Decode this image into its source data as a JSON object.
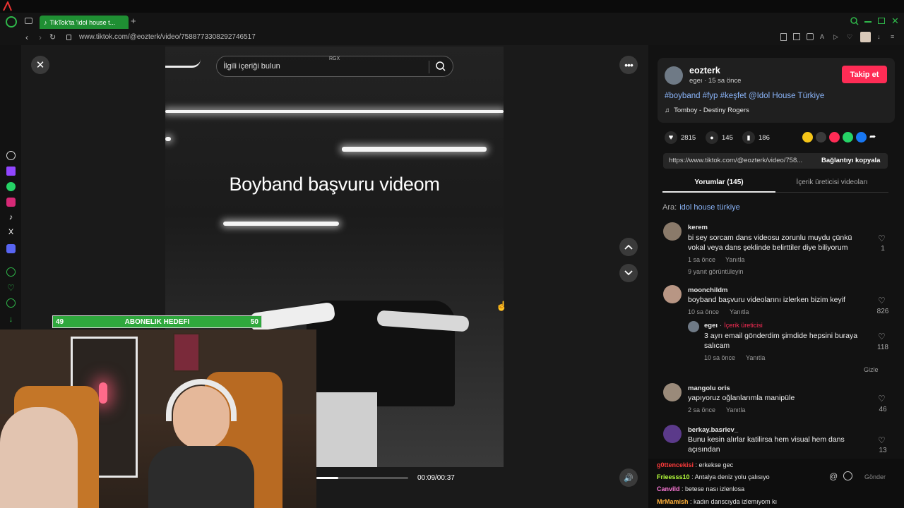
{
  "browser": {
    "tab_title": "TikTok'ta 'idol house t...",
    "url": "www.tiktok.com/@eozterk/video/7588773308292746517"
  },
  "video": {
    "search_placeholder": "İlgili içeriği bulun",
    "search_badge": "RGX",
    "overlay_text": "Boyband başvuru videom",
    "time": "00:09/00:37",
    "progress": 0.24
  },
  "stream": {
    "goal_label": "ABONELIK HEDEFI",
    "goal_current": "49",
    "goal_target": "50"
  },
  "post": {
    "username": "eozterk",
    "meta": "egeı · 15 sa önce",
    "follow_label": "Takip et",
    "caption": "#boyband #fyp #keşfet @Idol House Türkiye",
    "music": "Tomboy - Destiny Rogers",
    "likes": "2815",
    "comments": "145",
    "saves": "186",
    "link": "https://www.tiktok.com/@eozterk/video/758...",
    "copy_label": "Bağlantıyı kopyala"
  },
  "tabs": {
    "comments": "Yorumlar (145)",
    "creator_videos": "İçerik üreticisi videoları"
  },
  "related_search": {
    "prefix": "Ara:",
    "query": "idol house türkiye"
  },
  "comments": [
    {
      "user": "kerem",
      "text": "bi sey sorcam dans videosu zorunlu muydu çünkü vokal veya dans şeklinde belirttiler diye biliyorum",
      "time": "1 sa önce",
      "reply": "Yanıtla",
      "likes": "1",
      "more": "9 yanıt görüntüleyin"
    },
    {
      "user": "moonchildm",
      "text": "boyband başvuru videolarını izlerken bizim keyif",
      "time": "10 sa önce",
      "reply": "Yanıtla",
      "likes": "826"
    },
    {
      "user": "egeı",
      "badge": "İçerik üreticisi",
      "text": "3 ayrı email gönderdim şimdide hepsini buraya salıcam",
      "time": "10 sa önce",
      "reply": "Yanıtla",
      "likes": "118",
      "hide": "Gizle"
    },
    {
      "user": "mangolu oris",
      "text": "yapıyoruz oğlanlarımla manipüle",
      "time": "2 sa önce",
      "reply": "Yanıtla",
      "likes": "46"
    },
    {
      "user": "berkay.basriev_",
      "text": "Bunu kesin alırlar katilirsa hem visual hem dans açısından",
      "likes": "13"
    }
  ],
  "chat": {
    "send_label": "Gönder",
    "messages": [
      {
        "user": "g0ttencekisi",
        "text": ": erkekse gec",
        "color": "#ff3b3b"
      },
      {
        "user": "Frieesss10",
        "text": ": Antalya deniz yolu çalısıyo",
        "color": "#b6ff3b"
      },
      {
        "user": "Canvild",
        "text": ": betese nası izlenlosa",
        "color": "#ff7ad9"
      },
      {
        "user": "MrMamish",
        "text": ": kadın danscıyda izlemıyom kı",
        "color": "#ffb13b"
      }
    ]
  },
  "colors": {
    "accent_green": "#1f8f33",
    "follow_red": "#fe2c55",
    "hashtag_blue": "#8ab4f8"
  }
}
